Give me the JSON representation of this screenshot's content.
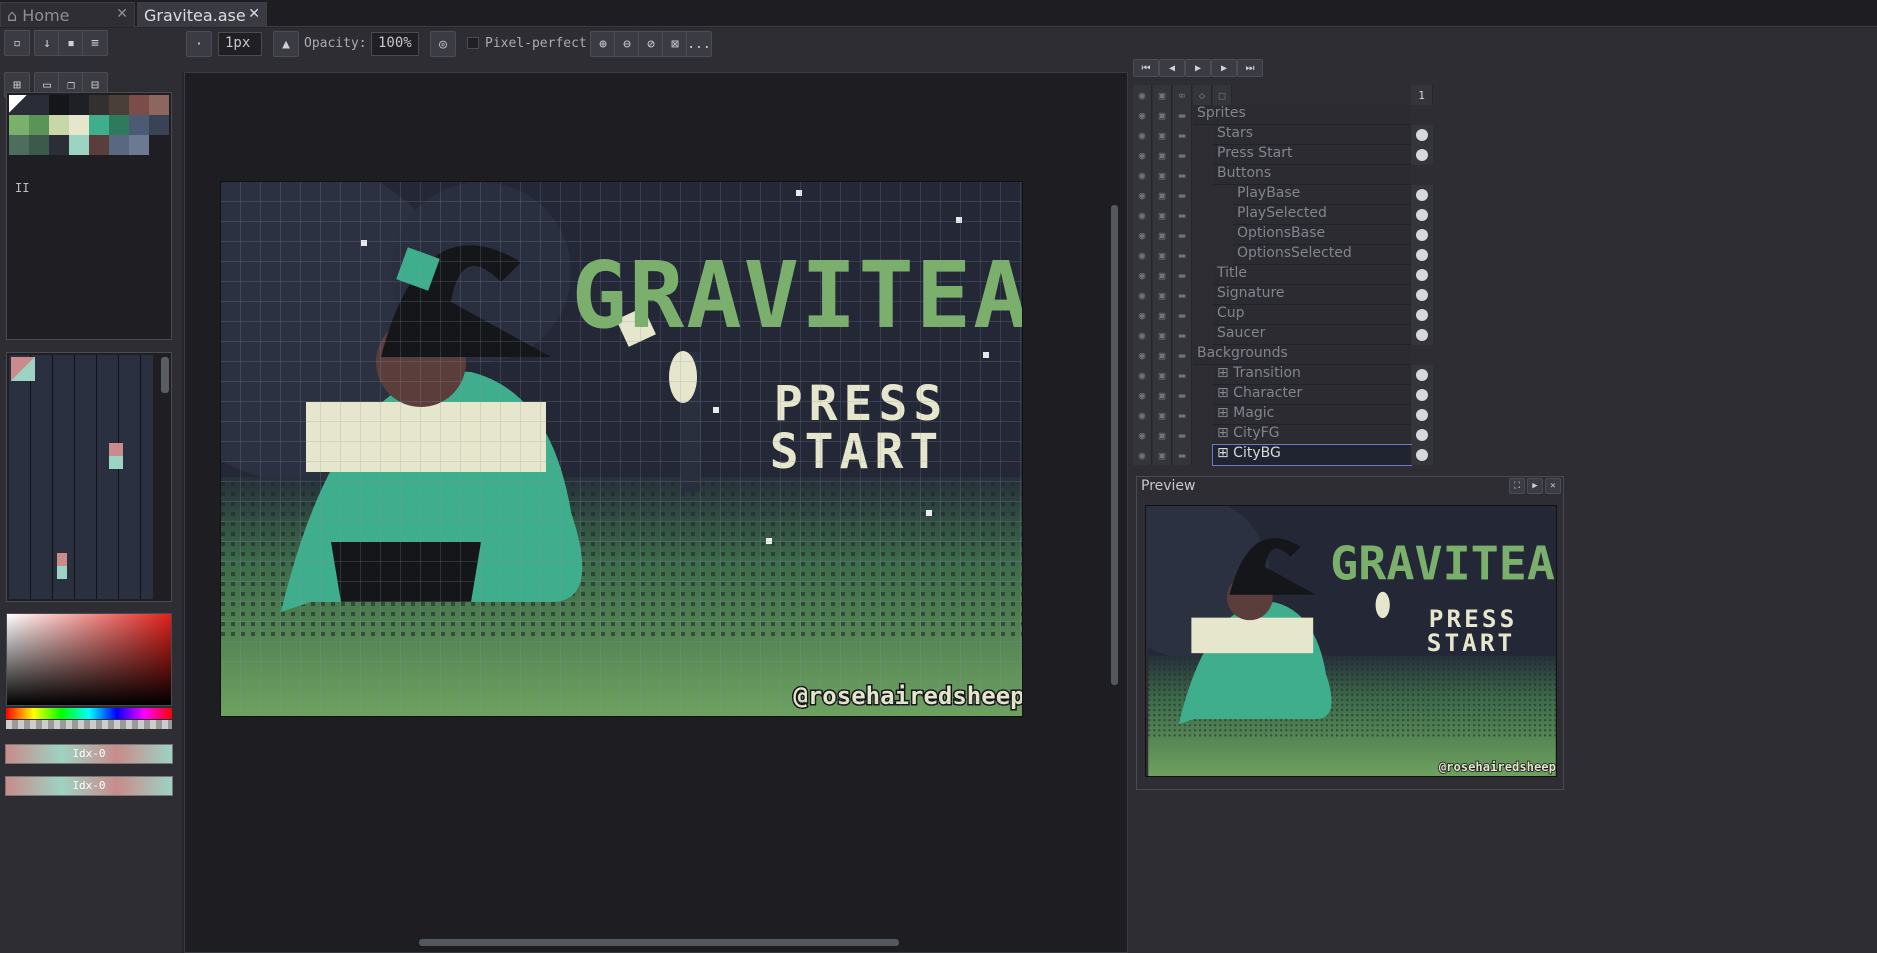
{
  "tabs": [
    {
      "label": "Home",
      "icon": "home-icon"
    },
    {
      "label": "Gravitea.ase",
      "active": true
    }
  ],
  "toolbar": {
    "brush_size": "1px",
    "opacity_label": "Opacity:",
    "opacity_value": "100%",
    "pixel_perfect_label": "Pixel-perfect",
    "more_label": "..."
  },
  "palette": {
    "colors": [
      "#2a2d38",
      "#15161a",
      "#1f2026",
      "#34302f",
      "#4b3f3a",
      "#7a4d4a",
      "#8e6660",
      "#7bb06c",
      "#5a9457",
      "#c8d6a8",
      "#e6e6cc",
      "#3fae8c",
      "#2e7a5c",
      "#4d5a74",
      "#3a4256",
      "#4d6e5c",
      "#3b5a4a",
      "#2b2d37",
      "#9dd3c2",
      "#5b3e3b",
      "#5a6780",
      "#6b7a92"
    ]
  },
  "index_labels": [
    "Idx-0",
    "Idx-0"
  ],
  "art": {
    "title": "GRAVITEA",
    "press": "PRESS",
    "start": "START",
    "signature": "@rosehairedsheep"
  },
  "timeline": {
    "frame": "1"
  },
  "layers": [
    {
      "name": "Sprites",
      "indent": 0,
      "group": true
    },
    {
      "name": "Stars",
      "indent": 1
    },
    {
      "name": "Press Start",
      "indent": 1
    },
    {
      "name": "Buttons",
      "indent": 1,
      "group": true
    },
    {
      "name": "PlayBase",
      "indent": 2
    },
    {
      "name": "PlaySelected",
      "indent": 2
    },
    {
      "name": "OptionsBase",
      "indent": 2
    },
    {
      "name": "OptionsSelected",
      "indent": 2
    },
    {
      "name": "Title",
      "indent": 1
    },
    {
      "name": "Signature",
      "indent": 1
    },
    {
      "name": "Cup",
      "indent": 1
    },
    {
      "name": "Saucer",
      "indent": 1
    },
    {
      "name": "Backgrounds",
      "indent": 0,
      "group": true
    },
    {
      "name": "⊞ Transition",
      "indent": 1
    },
    {
      "name": "⊞ Character",
      "indent": 1
    },
    {
      "name": "⊞ Magic",
      "indent": 1
    },
    {
      "name": "⊞ CityFG",
      "indent": 1
    },
    {
      "name": "⊞ CityBG",
      "indent": 1,
      "selected": true
    }
  ],
  "preview": {
    "title": "Preview"
  }
}
